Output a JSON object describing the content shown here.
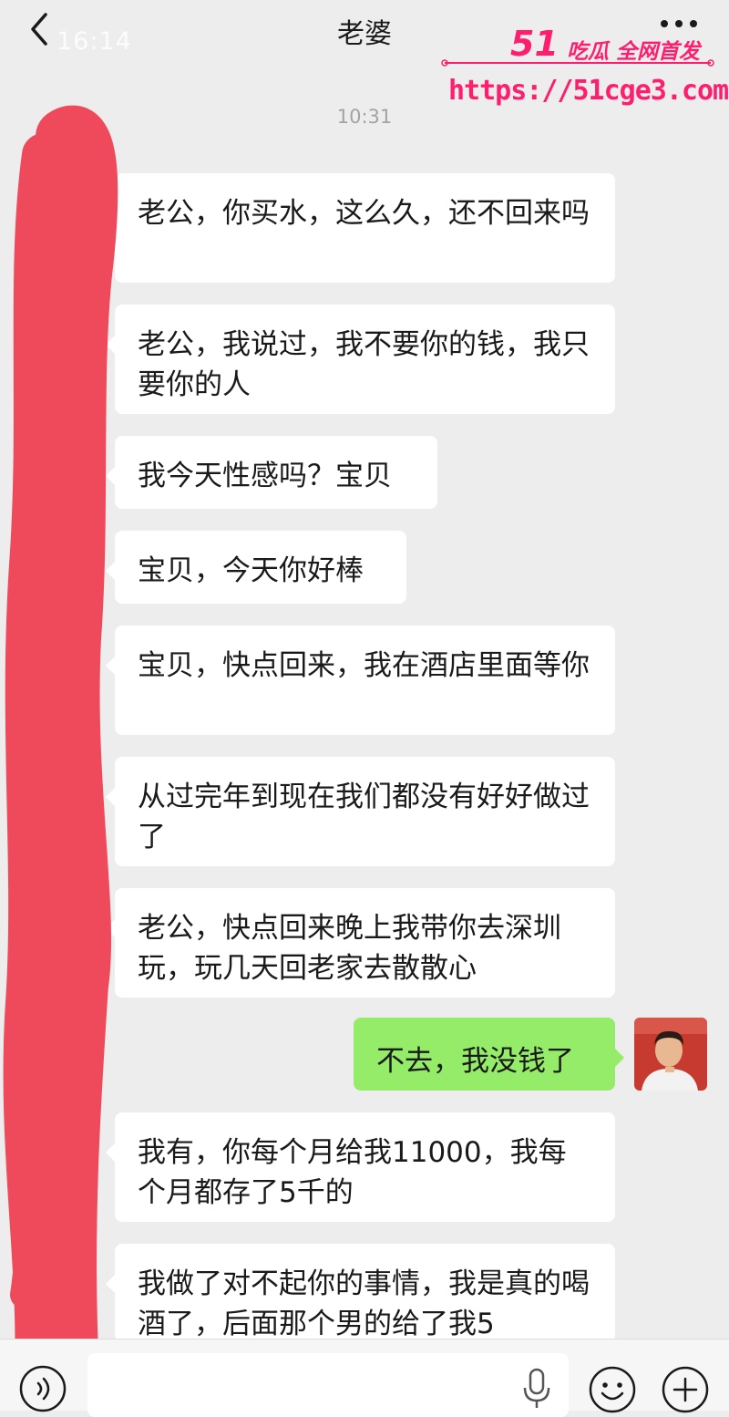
{
  "header": {
    "status_time": "16:14",
    "title": "老婆"
  },
  "watermark": {
    "logo_number": "51",
    "brand": "吃瓜 全网首发",
    "url": "https://51cge3.com"
  },
  "chat": {
    "timestamp": "10:31",
    "messages": [
      {
        "side": "received",
        "text": "老公，你买水，这么久，还不回来吗"
      },
      {
        "side": "received",
        "text": "老公，我说过，我不要你的钱，我只要你的人"
      },
      {
        "side": "received",
        "text": "我今天性感吗？宝贝"
      },
      {
        "side": "received",
        "text": "宝贝，今天你好棒"
      },
      {
        "side": "received",
        "text": "宝贝，快点回来，我在酒店里面等你"
      },
      {
        "side": "received",
        "text": "从过完年到现在我们都没有好好做过了"
      },
      {
        "side": "received",
        "text": "老公，快点回来晚上我带你去深圳玩，玩几天回老家去散散心"
      },
      {
        "side": "sent",
        "text": "不去，我没钱了"
      },
      {
        "side": "received",
        "text": "我有，你每个月给我11000，我每个月都存了5千的"
      },
      {
        "side": "received",
        "text": "我做了对不起你的事情，我是真的喝酒了，后面那个男的给了我5"
      }
    ]
  },
  "colors": {
    "background": "#ededed",
    "received_bubble": "#ffffff",
    "sent_bubble": "#95ec69",
    "scribble": "#ee4a5c",
    "watermark": "#ff1e6e"
  },
  "icons": {
    "back": "chevron-left-icon",
    "more": "more-dots-icon",
    "voice": "voice-icon",
    "mic": "mic-icon",
    "emoji": "emoji-icon",
    "plus": "plus-icon"
  }
}
